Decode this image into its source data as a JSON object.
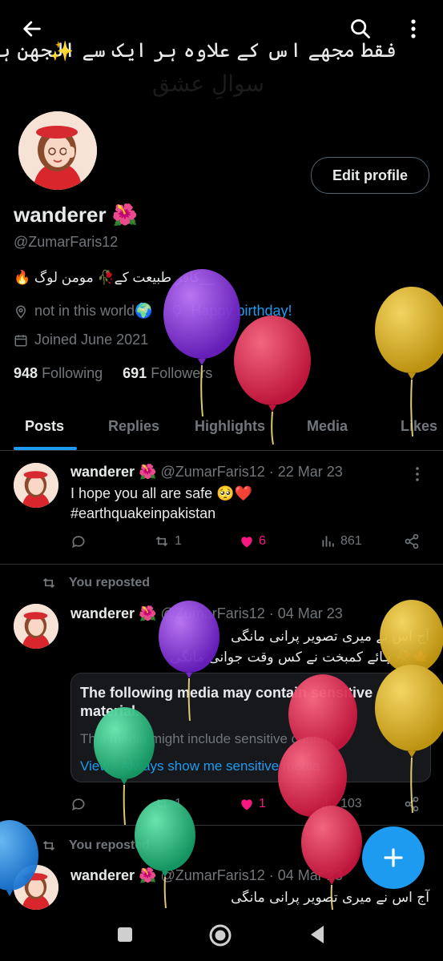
{
  "header": {
    "banner_text": "فقط مجھے اس کے علاوہ ہر ایک سے الجھن ہے",
    "banner_faint_text": "سوالِ عشق",
    "sparkle": "✨",
    "back_icon": "arrow-left-icon",
    "search_icon": "search-icon",
    "more_icon": "more-vertical-icon"
  },
  "profile": {
    "edit_label": "Edit profile",
    "name": "wanderer 🌺",
    "handle": "@ZumarFaris12",
    "bio": "🔥 کافر طبیعت کے🥀 مومن لوگ__",
    "location": "not in this world🌍",
    "birthday": "Happy birthday!",
    "joined": "Joined June 2021",
    "following_count": "948",
    "following_label": "Following",
    "followers_count": "691",
    "followers_label": "Followers"
  },
  "tabs": [
    {
      "label": "Posts",
      "active": true
    },
    {
      "label": "Replies"
    },
    {
      "label": "Highlights"
    },
    {
      "label": "Media"
    },
    {
      "label": "Likes"
    }
  ],
  "tweets": [
    {
      "name": "wanderer 🌺",
      "meta": "@ZumarFaris12 · 22 Mar 23",
      "text": "I hope you all are safe 🥺❤️",
      "hashtag": "#earthquakeinpakistan",
      "reposts": "1",
      "likes": "6",
      "views": "861"
    },
    {
      "repost_label": "You reposted",
      "name": "wanderer 🌺",
      "meta": "@ZumarFaris12 · 04 Mar 23",
      "urdu_line1": "آج اس نے میری تصویر پرانی مانگی",
      "urdu_line2": "🍁🥀 ہائے کمبخت نے کس وقت جوانی مانگی",
      "sensitive_title": "The following media may contain sensitive material.",
      "sensitive_sub": "This media might include sensitive content",
      "sensitive_links": "View · Always show me sensitive media",
      "reposts": "1",
      "likes": "1",
      "views": "103"
    },
    {
      "repost_label": "You reposted",
      "name": "wanderer 🌺",
      "meta": "@ZumarFaris12 · 04 Mar 23",
      "urdu_line1": "آج اس نے میری تصویر پرانی مانگی"
    }
  ],
  "fab": {
    "icon": "plus-icon"
  },
  "colors": {
    "accent": "#1d9bf0",
    "like": "#f91880",
    "background": "#000000",
    "muted": "#71767b"
  }
}
